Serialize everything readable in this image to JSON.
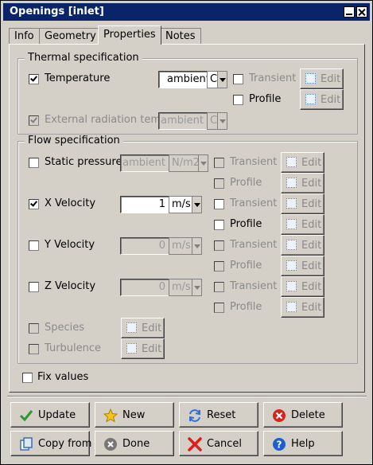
{
  "window": {
    "title": "Openings [inlet]"
  },
  "tabs": [
    {
      "label": "Info"
    },
    {
      "label": "Geometry"
    },
    {
      "label": "Properties",
      "active": true
    },
    {
      "label": "Notes"
    }
  ],
  "thermal": {
    "title": "Thermal specification",
    "temperature": {
      "label": "Temperature",
      "checked": true,
      "value": "ambient",
      "unit": "C"
    },
    "transient_label": "Transient",
    "profile_label": "Profile",
    "edit_label": "Edit",
    "ext_rad": {
      "label": "External radiation temp",
      "checked": true,
      "value": "ambient",
      "unit": "C"
    }
  },
  "flow": {
    "title": "Flow specification",
    "static_pressure": {
      "label": "Static pressure",
      "value": "ambient",
      "unit": "N/m2"
    },
    "x_velocity": {
      "label": "X Velocity",
      "checked": true,
      "value": "1",
      "unit": "m/s"
    },
    "y_velocity": {
      "label": "Y Velocity",
      "value": "0",
      "unit": "m/s"
    },
    "z_velocity": {
      "label": "Z Velocity",
      "value": "0",
      "unit": "m/s"
    },
    "species": {
      "label": "Species"
    },
    "turbulence": {
      "label": "Turbulence"
    },
    "transient_label": "Transient",
    "profile_label": "Profile",
    "edit_label": "Edit"
  },
  "fix_values": {
    "label": "Fix values"
  },
  "buttons": {
    "update": "Update",
    "new": "New",
    "reset": "Reset",
    "delete": "Delete",
    "copy_from": "Copy from",
    "done": "Done",
    "cancel": "Cancel",
    "help": "Help"
  }
}
